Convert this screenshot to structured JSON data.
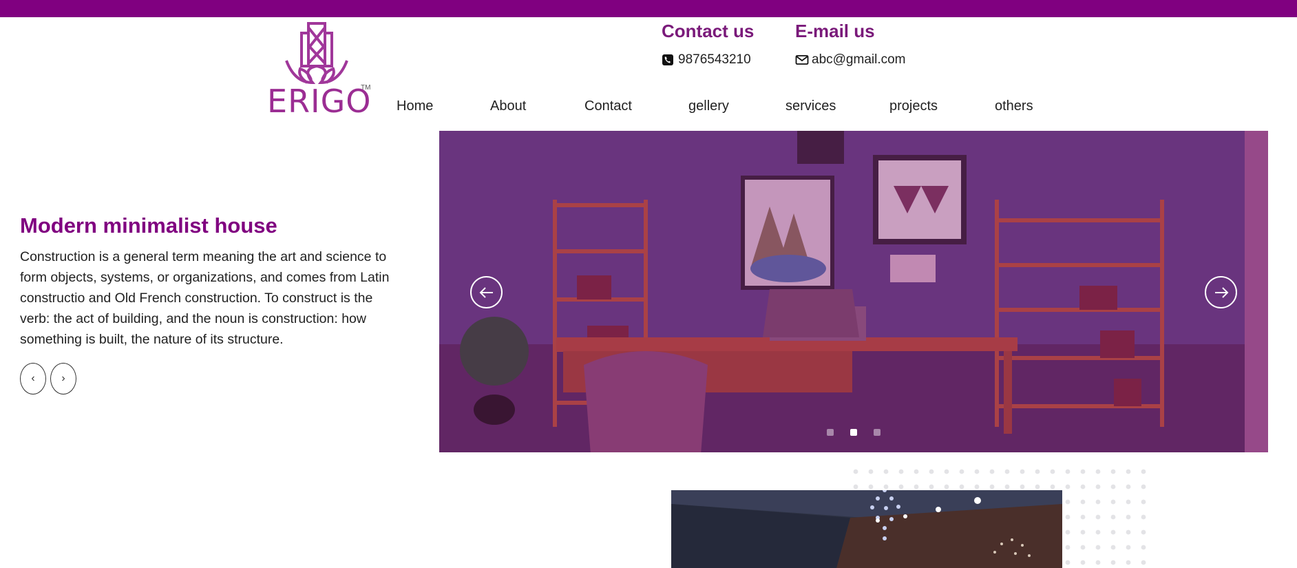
{
  "brand": {
    "logo_text": "ERIGO",
    "trademark": "TM",
    "accent_color": "#800080"
  },
  "contact": {
    "phone_title": "Contact us",
    "phone_number": "9876543210",
    "phone_icon": "phone-icon",
    "email_title": "E-mail us",
    "email_address": "abc@gmail.com",
    "email_icon": "envelope-icon"
  },
  "nav": {
    "items": [
      {
        "label": "Home"
      },
      {
        "label": "About"
      },
      {
        "label": "Contact"
      },
      {
        "label": "gellery"
      },
      {
        "label": "services"
      },
      {
        "label": "projects"
      },
      {
        "label": "others"
      }
    ]
  },
  "hero": {
    "title": "Modern minimalist house",
    "text": "Construction is a general term meaning the art and science to form objects, systems, or organizations, and comes from Latin constructio and Old French construction. To construct is the verb: the act of building, and the noun is construction: how something is built, the nature of its structure.",
    "prev_label": "‹",
    "next_label": "›"
  },
  "carousel": {
    "prev_icon": "arrow-left-icon",
    "next_icon": "arrow-right-icon",
    "slide_count": 3,
    "active_slide": 2
  }
}
